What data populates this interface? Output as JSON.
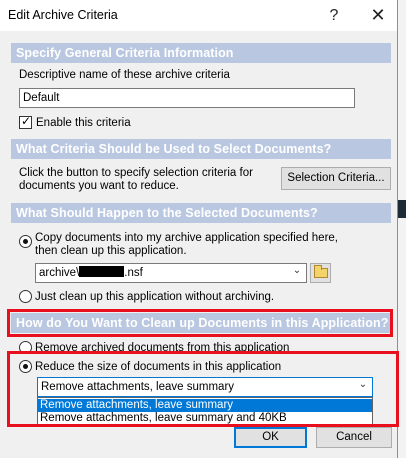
{
  "window": {
    "title": "Edit Archive Criteria",
    "help_glyph": "?",
    "close_glyph": "✕"
  },
  "sections": {
    "general": {
      "header": "Specify General Criteria Information",
      "name_label": "Descriptive name of these archive criteria",
      "name_value": "Default",
      "enable_label": "Enable this criteria",
      "enable_checked": true
    },
    "select": {
      "header": "What Criteria Should be Used to Select Documents?",
      "desc_line1": "Click the button to specify selection criteria for",
      "desc_line2": "documents you want to reduce.",
      "button_label": "Selection Criteria..."
    },
    "happen": {
      "header": "What Should Happen to the Selected Documents?",
      "copy_line1": "Copy documents into my archive application specified here,",
      "copy_line2": "then clean up this application.",
      "path_prefix": "archive\\",
      "path_suffix": ".nsf",
      "clean_only_label": "Just clean up this application without archiving."
    },
    "cleanup": {
      "header": "How do You Want to Clean up Documents in this Application?",
      "remove_label": "Remove archived documents from this application",
      "reduce_label": "Reduce the size of documents in this application",
      "selected_option": "Remove attachments, leave summary",
      "options": [
        "Remove attachments, leave summary",
        "Remove attachments, leave summary and 40KB"
      ]
    }
  },
  "footer": {
    "ok_label": "OK",
    "cancel_label": "Cancel"
  },
  "colors": {
    "section_bar": "#b9c7e0",
    "highlight": "#e8101e",
    "selection": "#0078d7"
  }
}
